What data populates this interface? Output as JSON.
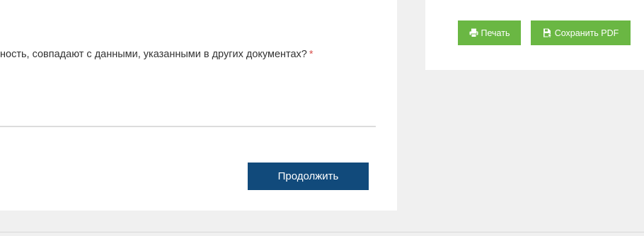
{
  "question": {
    "text": "ность, совпадают с данными, указанными в других документах?",
    "required_mark": "*"
  },
  "form": {
    "continue_label": "Продолжить"
  },
  "side_panel": {
    "print_label": "Печать",
    "print_icon": "print-icon",
    "save_pdf_label": "Сохранить PDF",
    "save_pdf_icon": "save-file-icon"
  },
  "colors": {
    "primary": "#114a7b",
    "success": "#6ab743",
    "required": "#d9534f",
    "background": "#f0f0f0"
  }
}
